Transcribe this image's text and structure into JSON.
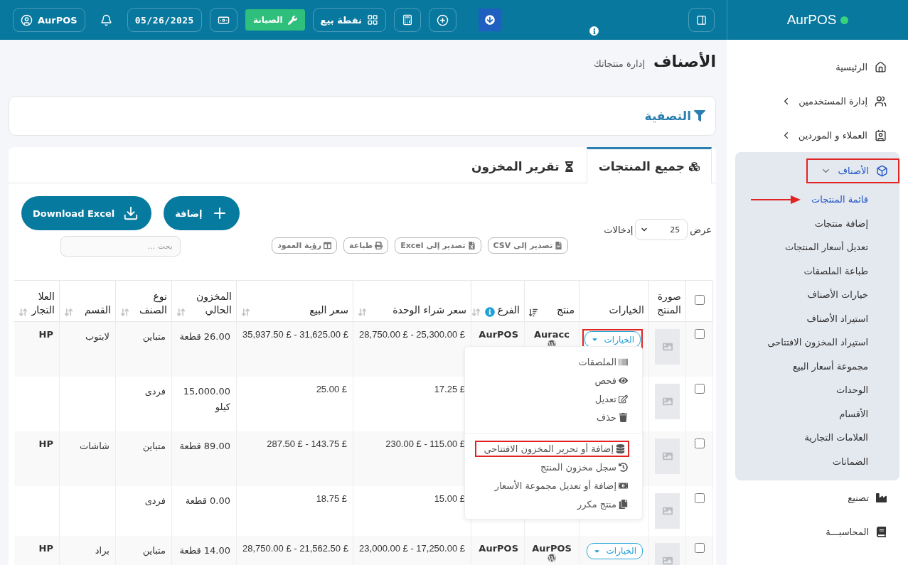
{
  "topbar": {
    "brand": "AurPOS",
    "profile": "AurPOS",
    "date": "05/26/2025",
    "maintenance": "الصيانة",
    "pos": "نقطة بيع"
  },
  "sidebar": {
    "items": [
      {
        "label": "الرئيسية",
        "annotated": false
      },
      {
        "label": "إدارة المستخدمين",
        "expanded": false,
        "annotated": false
      },
      {
        "label": "العملاء و الموردين",
        "expanded": false,
        "annotated": false
      },
      {
        "label": "الأصناف",
        "expanded": true,
        "annotated": true,
        "children": [
          {
            "label": "قائمة المنتجات",
            "selected": true,
            "pointer": true
          },
          {
            "label": "إضافة منتجات",
            "selected": false,
            "pointer": false
          },
          {
            "label": "تعديل أسعار المنتجات",
            "selected": false,
            "pointer": false
          },
          {
            "label": "طباعة الملصقات",
            "selected": false,
            "pointer": false
          },
          {
            "label": "خيارات الأصناف",
            "selected": false,
            "pointer": false
          },
          {
            "label": "استيراد الأصناف",
            "selected": false,
            "pointer": false
          },
          {
            "label": "استيراد المخزون الافتتاحى",
            "selected": false,
            "pointer": false
          },
          {
            "label": "مجموعة أسعار البيع",
            "selected": false,
            "pointer": false
          },
          {
            "label": "الوحدات",
            "selected": false,
            "pointer": false
          },
          {
            "label": "الأقسام",
            "selected": false,
            "pointer": false
          },
          {
            "label": "العلامات التجارية",
            "selected": false,
            "pointer": false
          },
          {
            "label": "الضمانات",
            "selected": false,
            "pointer": false
          }
        ]
      },
      {
        "label": "تصنيع",
        "annotated": false
      },
      {
        "label": "المحاسبـــة",
        "annotated": false
      }
    ]
  },
  "page": {
    "title": "الأصناف",
    "subtitle": "إدارة منتجاتك"
  },
  "filter": {
    "title": "التصفية"
  },
  "tabs": [
    {
      "label": "جميع المنتجات",
      "selected": true
    },
    {
      "label": "تقرير المخزون",
      "selected": false
    }
  ],
  "actions": {
    "add": "إضافة",
    "download": "Download Excel"
  },
  "entries": {
    "show": "عرض",
    "value": "25",
    "suffix": "إدخالات"
  },
  "exports": [
    "تصدير إلى CSV",
    "تصدير إلى Excel",
    "طباعة",
    "رؤية العمود"
  ],
  "search": {
    "placeholder": "بحث ..."
  },
  "table": {
    "select_all": {
      "checked": false
    },
    "columns": [
      {
        "label": "صورة المنتج"
      },
      {
        "label": "الخيارات"
      },
      {
        "label": "منتج",
        "sortable": true,
        "sorted": true,
        "info": false
      },
      {
        "label": "الفرع",
        "sortable": true,
        "sorted": false,
        "info": true
      },
      {
        "label": "سعر شراء الوحدة",
        "sortable": true,
        "sorted": false,
        "info": false
      },
      {
        "label": "سعر البيع",
        "sortable": true,
        "sorted": false,
        "info": false
      },
      {
        "label": "المخزون الحالي",
        "sortable": true,
        "sorted": false,
        "info": false
      },
      {
        "label": "نوع الصنف",
        "sortable": true,
        "sorted": false,
        "info": false
      },
      {
        "label": "القسم",
        "sortable": true,
        "sorted": false,
        "info": false
      },
      {
        "label": "العلا التجار",
        "sortable": true,
        "sorted": false,
        "info": false
      }
    ],
    "rows": [
      {
        "checked": false,
        "options": {
          "label": "الخيارات",
          "annotated": true
        },
        "product": "Auracc",
        "branch": "AurPOS",
        "purchase": "28,750.00 £ - 25,300.00 £",
        "sell": "35,937.50 £ - 31,625.00 £",
        "stock": "26.00 قطعة",
        "type": "متباين",
        "category": "لابتوب",
        "brand": "HP"
      },
      {
        "checked": false,
        "purchase": "17.25 £",
        "sell": "25.00 £",
        "stock": "15,000.00 كيلو",
        "type": "فردى"
      },
      {
        "checked": false,
        "purchase": "230.00 £ - 115.00 £",
        "sell": "287.50 £ - 143.75 £",
        "stock": "89.00 قطعة",
        "type": "متباين",
        "category": "شاشات",
        "brand": "HP"
      },
      {
        "checked": false,
        "purchase": "15.00 £",
        "sell": "18.75 £",
        "stock": "0.00 قطعة",
        "type": "فردى"
      },
      {
        "checked": false,
        "options": {
          "label": "الخيارات",
          "annotated": false
        },
        "product": "AurPOS",
        "branch": "AurPOS",
        "purchase": "23,000.00 £ - 17,250.00 £",
        "sell": "28,750.00 £ - 21,562.50 £",
        "stock": "14.00 قطعة",
        "type": "متباين",
        "category": "براد",
        "brand": "HP"
      }
    ]
  },
  "options_menu": {
    "groups": [
      [
        {
          "label": "الملصقات",
          "annotated": false
        },
        {
          "label": "فحص",
          "annotated": false
        },
        {
          "label": "تعديل",
          "annotated": false
        },
        {
          "label": "حذف",
          "annotated": false
        }
      ],
      [
        {
          "label": "إضافة أو تحرير المخزون الافتتاحي",
          "annotated": true
        },
        {
          "label": "سجل مخزون المنتج",
          "annotated": false
        },
        {
          "label": "إضافة أو تعديل مجموعة الأسعار",
          "annotated": false
        },
        {
          "label": "منتج مكرر",
          "annotated": false
        }
      ]
    ]
  }
}
